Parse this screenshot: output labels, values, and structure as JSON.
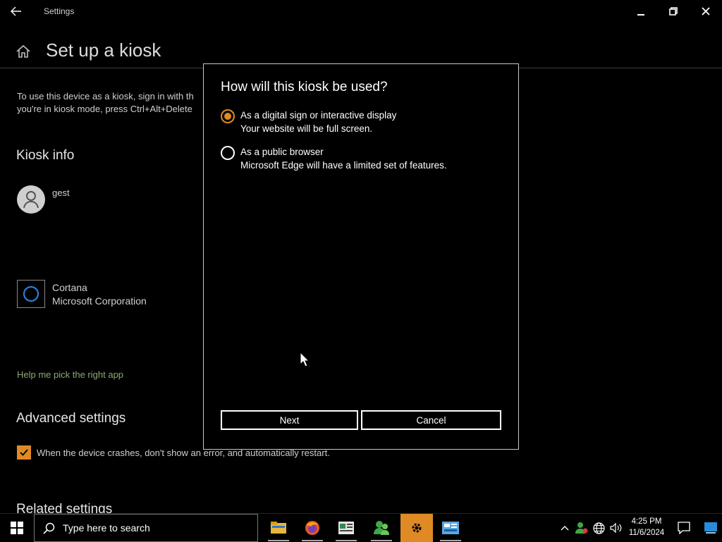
{
  "window": {
    "app_title": "Settings",
    "page_title": "Set up a kiosk"
  },
  "content": {
    "description_line1": "To use this device as a kiosk, sign in with th",
    "description_line2": "you're in kiosk mode, press Ctrl+Alt+Delete",
    "kiosk_info_heading": "Kiosk info",
    "account_name": "gest",
    "app_name": "Cortana",
    "app_publisher": "Microsoft Corporation",
    "help_link": "Help me pick the right app",
    "advanced_heading": "Advanced settings",
    "crash_checkbox_label": "When the device crashes, don't show an error, and automatically restart.",
    "crash_checkbox_checked": true,
    "related_heading": "Related settings"
  },
  "dialog": {
    "title": "How will this kiosk be used?",
    "options": [
      {
        "label": "As a digital sign or interactive display",
        "description": "Your website will be full screen.",
        "selected": true
      },
      {
        "label": "As a public browser",
        "description": "Microsoft Edge will have a limited set of features.",
        "selected": false
      }
    ],
    "next_label": "Next",
    "cancel_label": "Cancel"
  },
  "taskbar": {
    "search_placeholder": "Type here to search",
    "apps": [
      "file-explorer-icon",
      "firefox-icon",
      "news-app-icon",
      "people-app-icon",
      "settings-icon",
      "control-panel-icon"
    ],
    "time": "4:25 PM",
    "date": "11/6/2024"
  },
  "colors": {
    "accent": "#e08a25",
    "background": "#000000",
    "link": "#8fa874"
  }
}
